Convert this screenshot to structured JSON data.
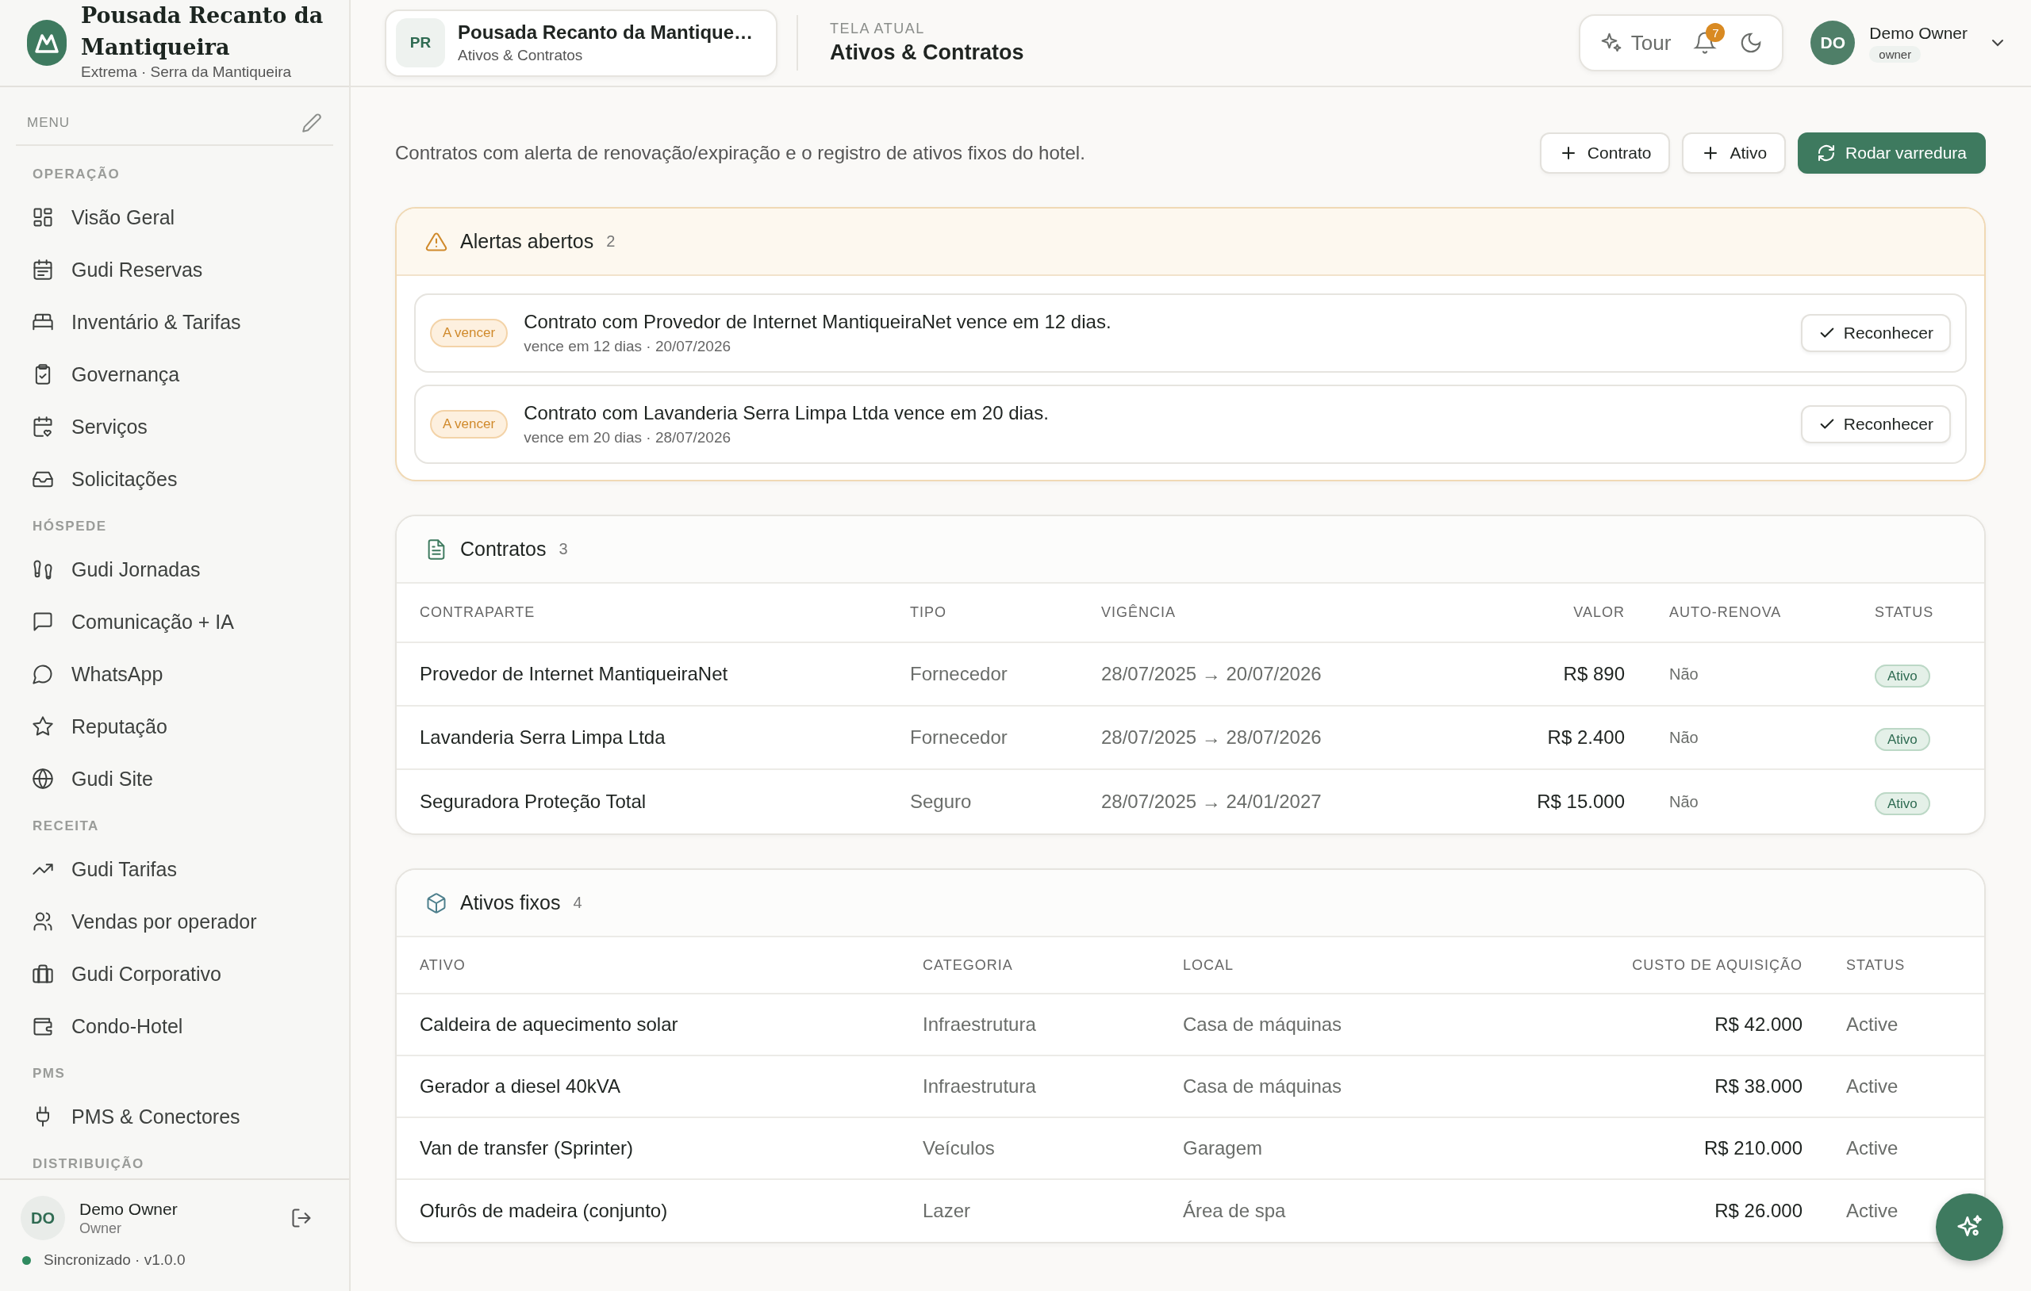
{
  "brand": {
    "name": "Pousada Recanto da Mantiqueira",
    "location": "Extrema · Serra da Mantiqueira"
  },
  "sidebar": {
    "menu_label": "MENU",
    "sections": [
      {
        "label": "OPERAÇÃO",
        "items": [
          {
            "label": "Visão Geral",
            "selected": false
          },
          {
            "label": "Gudi Reservas",
            "selected": false
          },
          {
            "label": "Inventário & Tarifas",
            "selected": false
          },
          {
            "label": "Governança",
            "selected": false
          },
          {
            "label": "Serviços",
            "selected": false
          },
          {
            "label": "Solicitações",
            "selected": false
          }
        ]
      },
      {
        "label": "HÓSPEDE",
        "items": [
          {
            "label": "Gudi Jornadas",
            "selected": false
          },
          {
            "label": "Comunicação + IA",
            "selected": false
          },
          {
            "label": "WhatsApp",
            "selected": false
          },
          {
            "label": "Reputação",
            "selected": false
          },
          {
            "label": "Gudi Site",
            "selected": false
          }
        ]
      },
      {
        "label": "RECEITA",
        "items": [
          {
            "label": "Gudi Tarifas",
            "selected": false
          },
          {
            "label": "Vendas por operador",
            "selected": false
          },
          {
            "label": "Gudi Corporativo",
            "selected": false
          },
          {
            "label": "Condo-Hotel",
            "selected": false
          }
        ]
      },
      {
        "label": "PMS",
        "items": [
          {
            "label": "PMS & Conectores",
            "selected": false
          }
        ]
      },
      {
        "label": "DISTRIBUIÇÃO"
      }
    ],
    "user": {
      "initials": "DO",
      "name": "Demo Owner",
      "role": "Owner"
    },
    "sync": "Sincronizado · v1.0.0"
  },
  "topbar": {
    "context": {
      "initials": "PR",
      "name": "Pousada Recanto da Mantique…",
      "subtitle": "Ativos & Contratos"
    },
    "screen_label": "TELA ATUAL",
    "screen_title": "Ativos & Contratos",
    "tour": "Tour",
    "notifications": "7",
    "user": {
      "initials": "DO",
      "name": "Demo Owner",
      "role": "owner"
    }
  },
  "description": "Contratos com alerta de renovação/expiração e o registro de ativos fixos do hotel.",
  "actions": [
    {
      "label": "Contrato",
      "kind": "add"
    },
    {
      "label": "Ativo",
      "kind": "add"
    },
    {
      "label": "Rodar varredura",
      "kind": "scan"
    }
  ],
  "alerts": {
    "title": "Alertas abertos",
    "count": "2",
    "items": [
      {
        "badge": "A vencer",
        "message": "Contrato com Provedor de Internet MantiqueiraNet vence em 12 dias.",
        "detail": "vence em 12 dias · 20/07/2026",
        "action": "Reconhecer"
      },
      {
        "badge": "A vencer",
        "message": "Contrato com Lavanderia Serra Limpa Ltda vence em 20 dias.",
        "detail": "vence em 20 dias · 28/07/2026",
        "action": "Reconhecer"
      }
    ]
  },
  "contracts": {
    "title": "Contratos",
    "count": "3",
    "columns": [
      "CONTRAPARTE",
      "TIPO",
      "VIGÊNCIA",
      "VALOR",
      "AUTO-RENOVA",
      "STATUS"
    ],
    "rows": [
      {
        "counterparty": "Provedor de Internet MantiqueiraNet",
        "type": "Fornecedor",
        "term": "28/07/2025 → 20/07/2026",
        "value": "R$ 890",
        "auto_renew": "Não",
        "status": "Ativo"
      },
      {
        "counterparty": "Lavanderia Serra Limpa Ltda",
        "type": "Fornecedor",
        "term": "28/07/2025 → 28/07/2026",
        "value": "R$ 2.400",
        "auto_renew": "Não",
        "status": "Ativo"
      },
      {
        "counterparty": "Seguradora Proteção Total",
        "type": "Seguro",
        "term": "28/07/2025 → 24/01/2027",
        "value": "R$ 15.000",
        "auto_renew": "Não",
        "status": "Ativo"
      }
    ]
  },
  "assets": {
    "title": "Ativos fixos",
    "count": "4",
    "columns": [
      "ATIVO",
      "CATEGORIA",
      "LOCAL",
      "CUSTO DE AQUISIÇÃO",
      "STATUS"
    ],
    "rows": [
      {
        "asset": "Caldeira de aquecimento solar",
        "category": "Infraestrutura",
        "location": "Casa de máquinas",
        "cost": "R$ 42.000",
        "status": "Active"
      },
      {
        "asset": "Gerador a diesel 40kVA",
        "category": "Infraestrutura",
        "location": "Casa de máquinas",
        "cost": "R$ 38.000",
        "status": "Active"
      },
      {
        "asset": "Van de transfer (Sprinter)",
        "category": "Veículos",
        "location": "Garagem",
        "cost": "R$ 210.000",
        "status": "Active"
      },
      {
        "asset": "Ofurôs de madeira (conjunto)",
        "category": "Lazer",
        "location": "Área de spa",
        "cost": "R$ 26.000",
        "status": "Active"
      }
    ]
  }
}
